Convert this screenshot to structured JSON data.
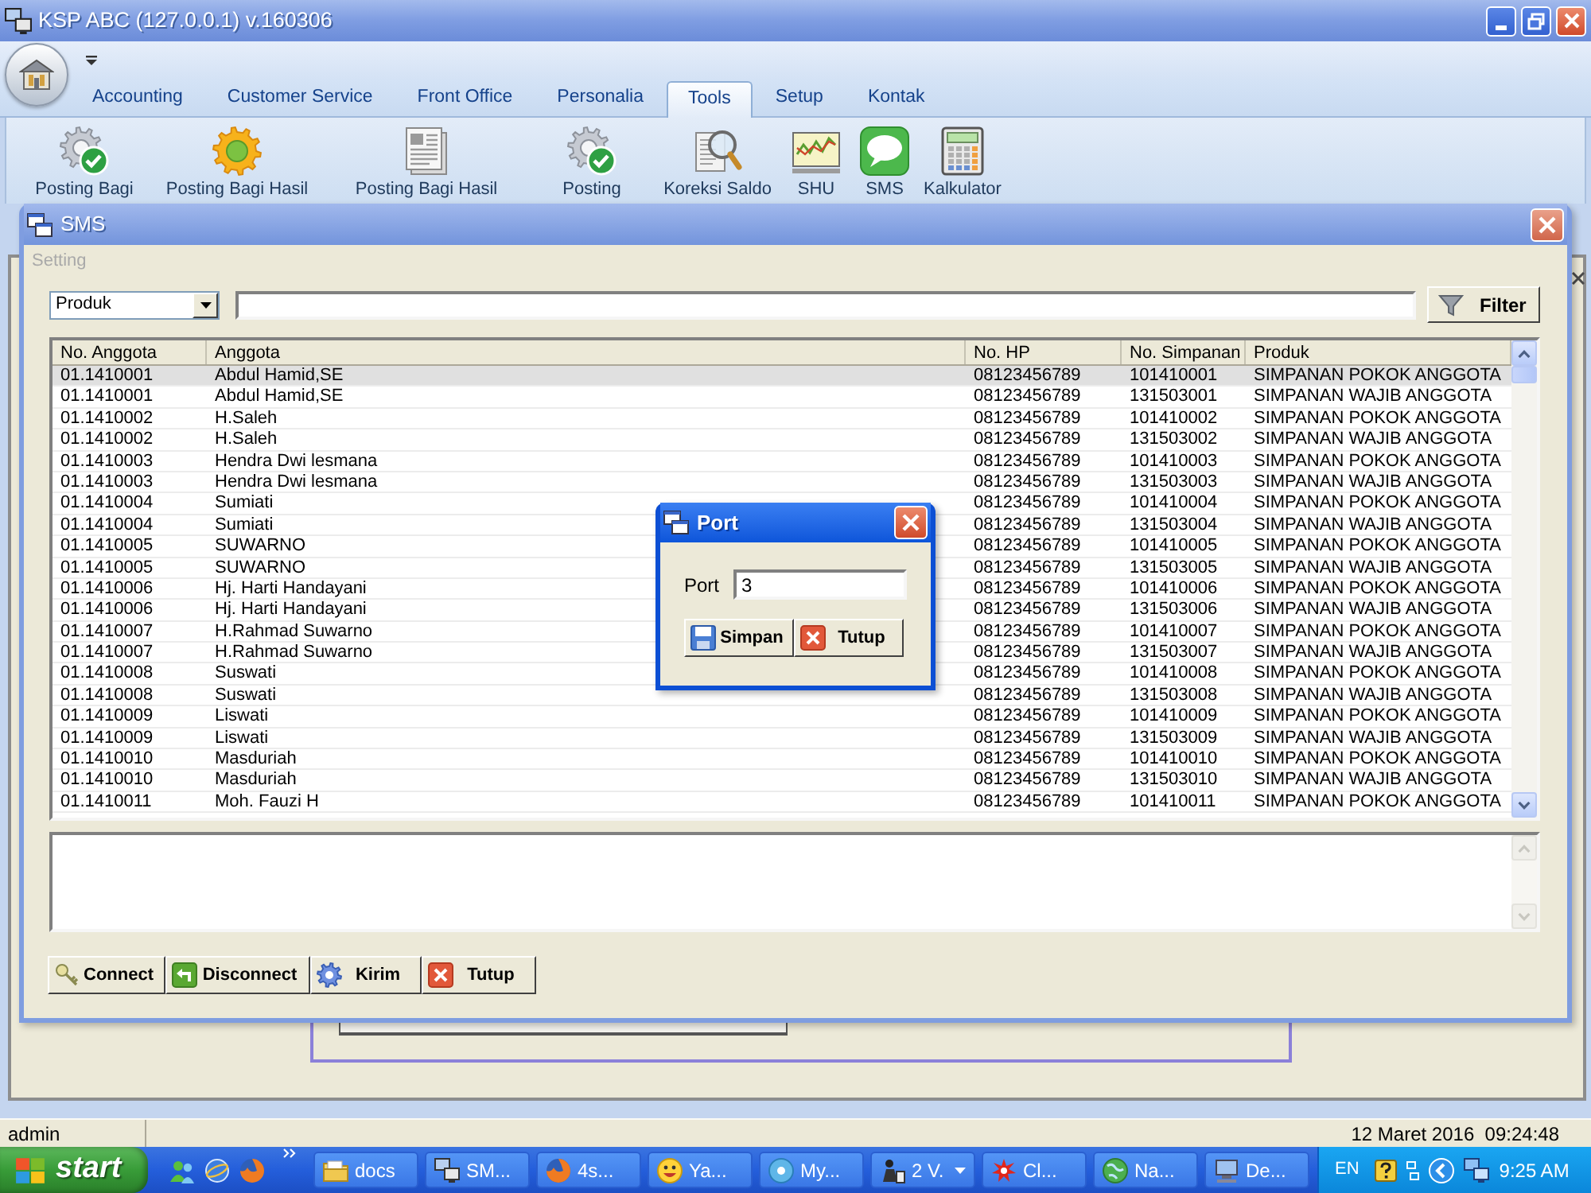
{
  "window": {
    "title": "KSP ABC (127.0.0.1) v.160306"
  },
  "ribbon": {
    "tabs": [
      {
        "label": "Accounting",
        "selected": false
      },
      {
        "label": "Customer Service",
        "selected": false
      },
      {
        "label": "Front Office",
        "selected": false
      },
      {
        "label": "Personalia",
        "selected": false
      },
      {
        "label": "Tools",
        "selected": true
      },
      {
        "label": "Setup",
        "selected": false
      },
      {
        "label": "Kontak",
        "selected": false
      }
    ],
    "tools": [
      {
        "label": "Posting Bagi",
        "kind": "gear-check"
      },
      {
        "label": "Posting Bagi Hasil",
        "kind": "gear"
      },
      {
        "label": "Posting Bagi Hasil",
        "kind": "document"
      },
      {
        "label": "Posting",
        "kind": "gear-check"
      },
      {
        "label": "Koreksi Saldo",
        "kind": "inspect"
      },
      {
        "label": "SHU",
        "kind": "chart"
      },
      {
        "label": "SMS",
        "kind": "sms"
      },
      {
        "label": "Kalkulator",
        "kind": "calculator"
      }
    ]
  },
  "sms_window": {
    "title": "SMS",
    "section_label": "Setting",
    "filter": {
      "column": "Produk",
      "button": "Filter"
    },
    "table": {
      "columns": [
        "No. Anggota",
        "Anggota",
        "No. HP",
        "No. Simpanan",
        "Produk"
      ],
      "rows": [
        {
          "cells": [
            "01.1410001",
            "Abdul Hamid,SE",
            "08123456789",
            "101410001",
            "SIMPANAN POKOK ANGGOTA"
          ],
          "selected": true
        },
        {
          "cells": [
            "01.1410001",
            "Abdul Hamid,SE",
            "08123456789",
            "131503001",
            "SIMPANAN WAJIB ANGGOTA"
          ],
          "selected": false
        },
        {
          "cells": [
            "01.1410002",
            "H.Saleh",
            "08123456789",
            "101410002",
            "SIMPANAN POKOK ANGGOTA"
          ],
          "selected": false
        },
        {
          "cells": [
            "01.1410002",
            "H.Saleh",
            "08123456789",
            "131503002",
            "SIMPANAN WAJIB ANGGOTA"
          ],
          "selected": false
        },
        {
          "cells": [
            "01.1410003",
            "Hendra Dwi lesmana",
            "08123456789",
            "101410003",
            "SIMPANAN POKOK ANGGOTA"
          ],
          "selected": false
        },
        {
          "cells": [
            "01.1410003",
            "Hendra Dwi lesmana",
            "08123456789",
            "131503003",
            "SIMPANAN WAJIB ANGGOTA"
          ],
          "selected": false
        },
        {
          "cells": [
            "01.1410004",
            "Sumiati",
            "08123456789",
            "101410004",
            "SIMPANAN POKOK ANGGOTA"
          ],
          "selected": false
        },
        {
          "cells": [
            "01.1410004",
            "Sumiati",
            "08123456789",
            "131503004",
            "SIMPANAN WAJIB ANGGOTA"
          ],
          "selected": false
        },
        {
          "cells": [
            "01.1410005",
            "SUWARNO",
            "08123456789",
            "101410005",
            "SIMPANAN POKOK ANGGOTA"
          ],
          "selected": false
        },
        {
          "cells": [
            "01.1410005",
            "SUWARNO",
            "08123456789",
            "131503005",
            "SIMPANAN WAJIB ANGGOTA"
          ],
          "selected": false
        },
        {
          "cells": [
            "01.1410006",
            "Hj. Harti Handayani",
            "08123456789",
            "101410006",
            "SIMPANAN POKOK ANGGOTA"
          ],
          "selected": false
        },
        {
          "cells": [
            "01.1410006",
            "Hj. Harti Handayani",
            "08123456789",
            "131503006",
            "SIMPANAN WAJIB ANGGOTA"
          ],
          "selected": false
        },
        {
          "cells": [
            "01.1410007",
            "H.Rahmad Suwarno",
            "08123456789",
            "101410007",
            "SIMPANAN POKOK ANGGOTA"
          ],
          "selected": false
        },
        {
          "cells": [
            "01.1410007",
            "H.Rahmad Suwarno",
            "08123456789",
            "131503007",
            "SIMPANAN WAJIB ANGGOTA"
          ],
          "selected": false
        },
        {
          "cells": [
            "01.1410008",
            "Suswati",
            "08123456789",
            "101410008",
            "SIMPANAN POKOK ANGGOTA"
          ],
          "selected": false
        },
        {
          "cells": [
            "01.1410008",
            "Suswati",
            "08123456789",
            "131503008",
            "SIMPANAN WAJIB ANGGOTA"
          ],
          "selected": false
        },
        {
          "cells": [
            "01.1410009",
            "Liswati",
            "08123456789",
            "101410009",
            "SIMPANAN POKOK ANGGOTA"
          ],
          "selected": false
        },
        {
          "cells": [
            "01.1410009",
            "Liswati",
            "08123456789",
            "131503009",
            "SIMPANAN WAJIB ANGGOTA"
          ],
          "selected": false
        },
        {
          "cells": [
            "01.1410010",
            "Masduriah",
            "08123456789",
            "101410010",
            "SIMPANAN POKOK ANGGOTA"
          ],
          "selected": false
        },
        {
          "cells": [
            "01.1410010",
            "Masduriah",
            "08123456789",
            "131503010",
            "SIMPANAN WAJIB ANGGOTA"
          ],
          "selected": false
        },
        {
          "cells": [
            "01.1410011",
            "Moh. Fauzi H",
            "08123456789",
            "101410011",
            "SIMPANAN POKOK ANGGOTA"
          ],
          "selected": false
        }
      ]
    },
    "buttons": [
      {
        "label": "Connect",
        "kind": "connect"
      },
      {
        "label": "Disconnect",
        "kind": "disconnect"
      },
      {
        "label": "Kirim",
        "kind": "send"
      },
      {
        "label": "Tutup",
        "kind": "close"
      }
    ]
  },
  "port_dialog": {
    "title": "Port",
    "field_label": "Port",
    "value": "3",
    "buttons": [
      {
        "label": "Simpan",
        "kind": "save"
      },
      {
        "label": "Tutup",
        "kind": "close"
      }
    ]
  },
  "status_bar": {
    "user": "admin",
    "datetime": "12 Maret 2016  09:24:48"
  },
  "taskbar": {
    "start": "start",
    "buttons": [
      {
        "label": "docs",
        "kind": "folder",
        "grouped": false
      },
      {
        "label": "SM...",
        "kind": "network",
        "grouped": false
      },
      {
        "label": "4s...",
        "kind": "ringed-globe",
        "grouped": false
      },
      {
        "label": "Ya...",
        "kind": "smiley",
        "grouped": false
      },
      {
        "label": "My...",
        "kind": "disc",
        "grouped": false
      },
      {
        "label": "2 V.",
        "kind": "figure",
        "grouped": true
      },
      {
        "label": "Cl...",
        "kind": "splash",
        "grouped": false
      },
      {
        "label": "Na...",
        "kind": "globe",
        "grouped": false
      },
      {
        "label": "De...",
        "kind": "computer",
        "grouped": false
      }
    ],
    "tray": {
      "language": "EN",
      "clock": "9:25 AM"
    }
  }
}
